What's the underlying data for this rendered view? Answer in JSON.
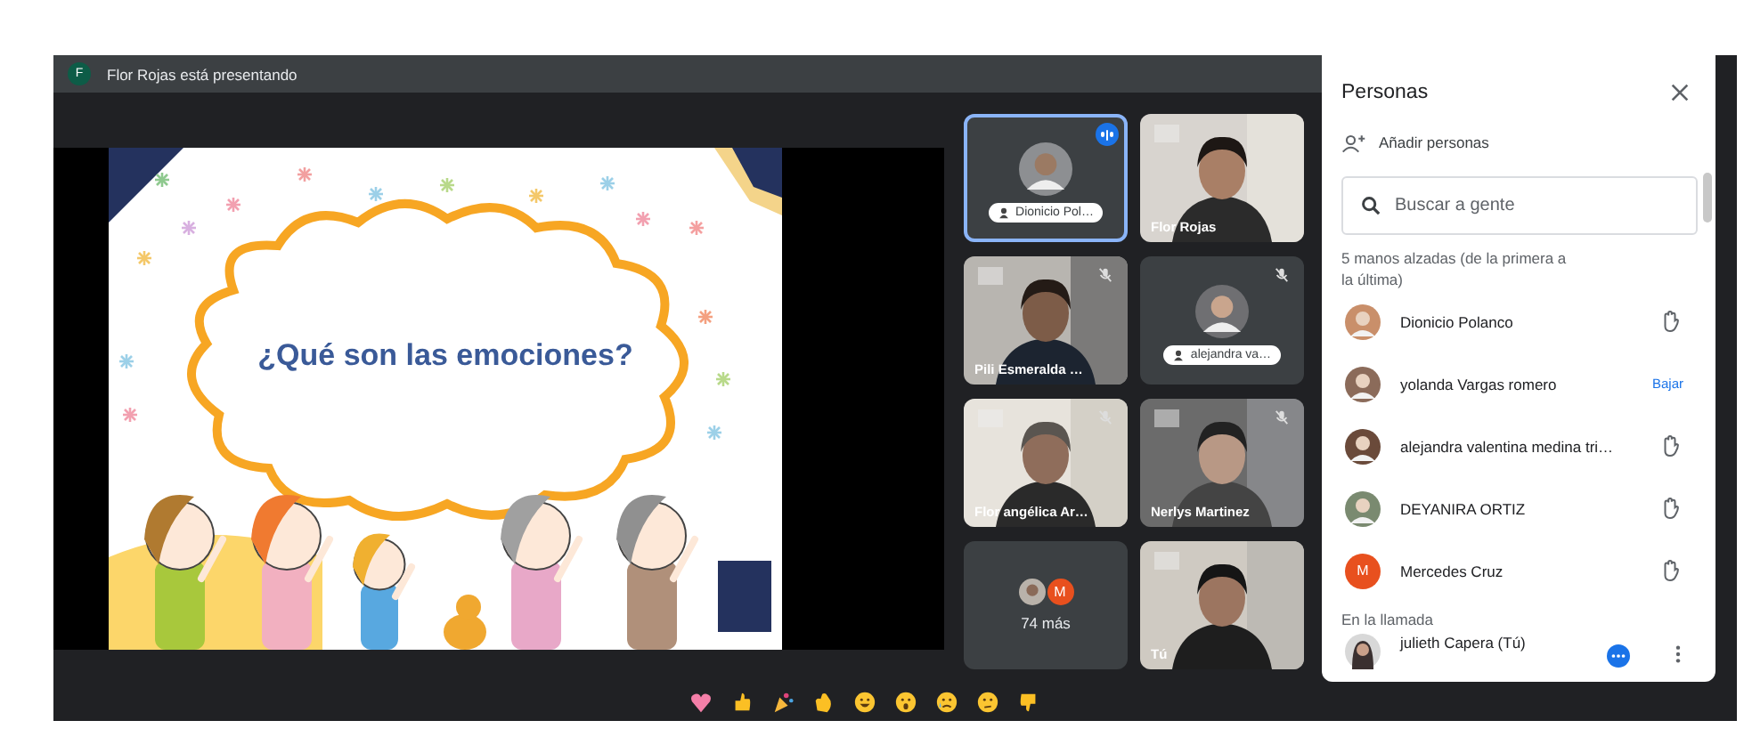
{
  "presenter_bar": {
    "avatar_letter": "F",
    "text": "Flor Rojas está presentando"
  },
  "slide": {
    "title": "¿Qué son las emociones?"
  },
  "tiles": [
    {
      "kind": "avatar",
      "name": "Dionicio Pol…",
      "speaking": true,
      "muted": false
    },
    {
      "kind": "video",
      "name": "Flor Rojas",
      "speaking": false,
      "muted": false
    },
    {
      "kind": "video",
      "name": "Pili Esmeralda …",
      "speaking": false,
      "muted": true
    },
    {
      "kind": "avatar",
      "name": "alejandra va…",
      "speaking": false,
      "muted": true
    },
    {
      "kind": "video",
      "name": "Flor angélica Ar…",
      "speaking": false,
      "muted": true
    },
    {
      "kind": "video",
      "name": "Nerlys Martinez",
      "speaking": false,
      "muted": true
    },
    {
      "kind": "more",
      "avatar_letter": "M",
      "count": "74 más"
    },
    {
      "kind": "video",
      "name": "Tú",
      "speaking": false,
      "muted": false
    }
  ],
  "people_panel": {
    "title": "Personas",
    "add_label": "Añadir personas",
    "search": {
      "placeholder": "Buscar a gente"
    },
    "raised_hands_heading": "5 manos alzadas (de la primera a la última)",
    "raised_hands": [
      {
        "name": "Dionicio Polanco",
        "kind": "hand"
      },
      {
        "name": "yolanda Vargas romero",
        "kind": "lower",
        "action_label": "Bajar"
      },
      {
        "name": "alejandra valentina medina tri…",
        "kind": "hand"
      },
      {
        "name": "DEYANIRA ORTIZ",
        "kind": "hand"
      },
      {
        "name": "Mercedes Cruz",
        "avatar_letter": "M",
        "kind": "hand"
      }
    ],
    "in_call_heading": "En la llamada",
    "in_call": [
      {
        "name": "julieth Capera (Tú)"
      }
    ]
  }
}
